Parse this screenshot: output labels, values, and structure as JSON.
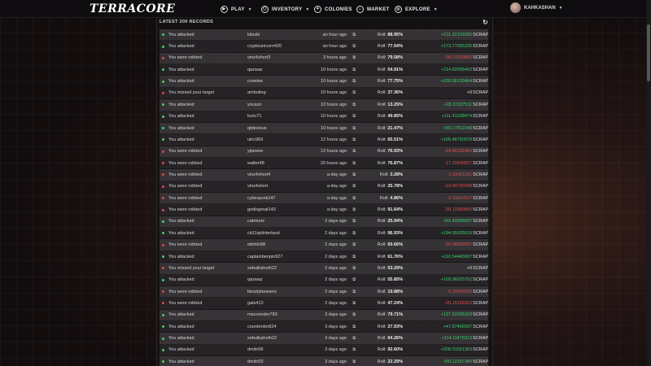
{
  "brand": "TERRACORE",
  "nav": [
    {
      "label": "PLAY",
      "icon": "play-icon",
      "has_caret": true,
      "x": 0
    },
    {
      "label": "INVENTORY",
      "icon": "inventory-icon",
      "has_caret": true,
      "x": 0
    },
    {
      "label": "COLONIES",
      "icon": "colonies-icon",
      "has_caret": false,
      "x": 0
    },
    {
      "label": "MARKET",
      "icon": "market-icon",
      "has_caret": false,
      "x": 0
    },
    {
      "label": "EXPLORE",
      "icon": "explore-icon",
      "has_caret": true,
      "x": 0
    }
  ],
  "user": {
    "name": "KAHKASHAN"
  },
  "records": {
    "title": "LATEST 200 RECORDS",
    "roll_label": "Roll:",
    "unit": "SCRAP",
    "rows": [
      {
        "type": "attack",
        "action": "You attacked",
        "player": "kitsuki",
        "time": "an hour ago",
        "roll": "88.95%",
        "scrap": "+211.22191655",
        "sign": "pos"
      },
      {
        "type": "attack",
        "action": "You attacked",
        "player": "cryptounicorn420",
        "time": "an hour ago",
        "roll": "77.54%",
        "scrap": "+173.77055335",
        "sign": "pos"
      },
      {
        "type": "robbed",
        "action": "You were robbed",
        "player": "vinz4short3",
        "time": "3 hours ago",
        "roll": "79.58%",
        "scrap": "-38.23520880",
        "sign": "neg"
      },
      {
        "type": "attack",
        "action": "You attacked",
        "player": "qazwaz",
        "time": "10 hours ago",
        "roll": "54.91%",
        "scrap": "+114.82595492",
        "sign": "pos"
      },
      {
        "type": "attack",
        "action": "You attacked",
        "player": "crowlee",
        "time": "10 hours ago",
        "roll": "77.75%",
        "scrap": "+159.56100464",
        "sign": "pos"
      },
      {
        "type": "missed",
        "action": "You missed your target",
        "player": "ambuting",
        "time": "10 hours ago",
        "roll": "37.36%",
        "scrap": "+0",
        "sign": "zero"
      },
      {
        "type": "attack",
        "action": "You attacked",
        "player": "yocazo",
        "time": "10 hours ago",
        "roll": "13.25%",
        "scrap": "+28.37337511",
        "sign": "pos"
      },
      {
        "type": "attack",
        "action": "You attacked",
        "player": "lozio71",
        "time": "10 hours ago",
        "roll": "49.85%",
        "scrap": "+111.41298474",
        "sign": "pos"
      },
      {
        "type": "attack",
        "action": "You attacked",
        "player": "qtdevious",
        "time": "10 hours ago",
        "roll": "21.47%",
        "scrap": "+50.17812348",
        "sign": "pos"
      },
      {
        "type": "attack",
        "action": "You attacked",
        "player": "ulric969",
        "time": "12 hours ago",
        "roll": "65.51%",
        "scrap": "+105.48750978",
        "sign": "pos"
      },
      {
        "type": "robbed",
        "action": "You were robbed",
        "player": "yipeeee",
        "time": "12 hours ago",
        "roll": "76.93%",
        "scrap": "-19.86292460",
        "sign": "neg"
      },
      {
        "type": "robbed",
        "action": "You were robbed",
        "player": "walter48",
        "time": "20 hours ago",
        "roll": "76.87%",
        "scrap": "-17.10430927",
        "sign": "neg"
      },
      {
        "type": "robbed",
        "action": "You were robbed",
        "player": "vinz4short4",
        "time": "a day ago",
        "roll": "3.28%",
        "scrap": "-1.02421161",
        "sign": "neg"
      },
      {
        "type": "robbed",
        "action": "You were robbed",
        "player": "vinz4short",
        "time": "a day ago",
        "roll": "25.78%",
        "scrap": "-10.84700348",
        "sign": "neg"
      },
      {
        "type": "robbed",
        "action": "You were robbed",
        "player": "cyberpunk147",
        "time": "a day ago",
        "roll": "4.86%",
        "scrap": "-2.15014117",
        "sign": "neg"
      },
      {
        "type": "robbed",
        "action": "You were robbed",
        "player": "godisgreat143",
        "time": "a day ago",
        "roll": "91.64%",
        "scrap": "-39.13390560",
        "sign": "neg"
      },
      {
        "type": "attack",
        "action": "You attacked",
        "player": "catotune",
        "time": "2 days ago",
        "roll": "25.94%",
        "scrap": "+52.43306697",
        "sign": "pos"
      },
      {
        "type": "attack",
        "action": "You attacked",
        "player": "cb11splinterland",
        "time": "2 days ago",
        "roll": "96.93%",
        "scrap": "+194.55025610",
        "sign": "pos"
      },
      {
        "type": "robbed",
        "action": "You were robbed",
        "player": "eibhlin98",
        "time": "2 days ago",
        "roll": "60.66%",
        "scrap": "-26.08862937",
        "sign": "neg"
      },
      {
        "type": "attack",
        "action": "You attacked",
        "player": "captainbenpin927",
        "time": "2 days ago",
        "roll": "61.76%",
        "scrap": "+110.54443007",
        "sign": "pos"
      },
      {
        "type": "missed",
        "action": "You missed your target",
        "player": "sebulbahoth22",
        "time": "2 days ago",
        "roll": "53.29%",
        "scrap": "+0",
        "sign": "zero"
      },
      {
        "type": "attack",
        "action": "You attacked",
        "player": "qazwaz",
        "time": "2 days ago",
        "roll": "55.85%",
        "scrap": "+109.96633752",
        "sign": "pos"
      },
      {
        "type": "robbed",
        "action": "You were robbed",
        "player": "bloodybeavers",
        "time": "2 days ago",
        "roll": "19.88%",
        "scrap": "-9.29816200",
        "sign": "neg"
      },
      {
        "type": "robbed",
        "action": "You were robbed",
        "player": "gale413",
        "time": "2 days ago",
        "roll": "47.24%",
        "scrap": "-26.15100323",
        "sign": "neg"
      },
      {
        "type": "attack",
        "action": "You attacked",
        "player": "macoendor783",
        "time": "3 days ago",
        "roll": "79.71%",
        "scrap": "+137.62925329",
        "sign": "pos"
      },
      {
        "type": "attack",
        "action": "You attacked",
        "player": "counterdor824",
        "time": "3 days ago",
        "roll": "27.93%",
        "scrap": "+47.87466937",
        "sign": "pos"
      },
      {
        "type": "attack",
        "action": "You attacked",
        "player": "sebulbahoth22",
        "time": "3 days ago",
        "roll": "64.26%",
        "scrap": "+114.11479313",
        "sign": "pos"
      },
      {
        "type": "attack",
        "action": "You attacked",
        "player": "dmitri06",
        "time": "3 days ago",
        "roll": "92.60%",
        "scrap": "+208.01621363",
        "sign": "pos"
      },
      {
        "type": "attack",
        "action": "You attacked",
        "player": "dmitri03",
        "time": "3 days ago",
        "roll": "22.29%",
        "scrap": "+50.12167340",
        "sign": "pos"
      }
    ]
  }
}
